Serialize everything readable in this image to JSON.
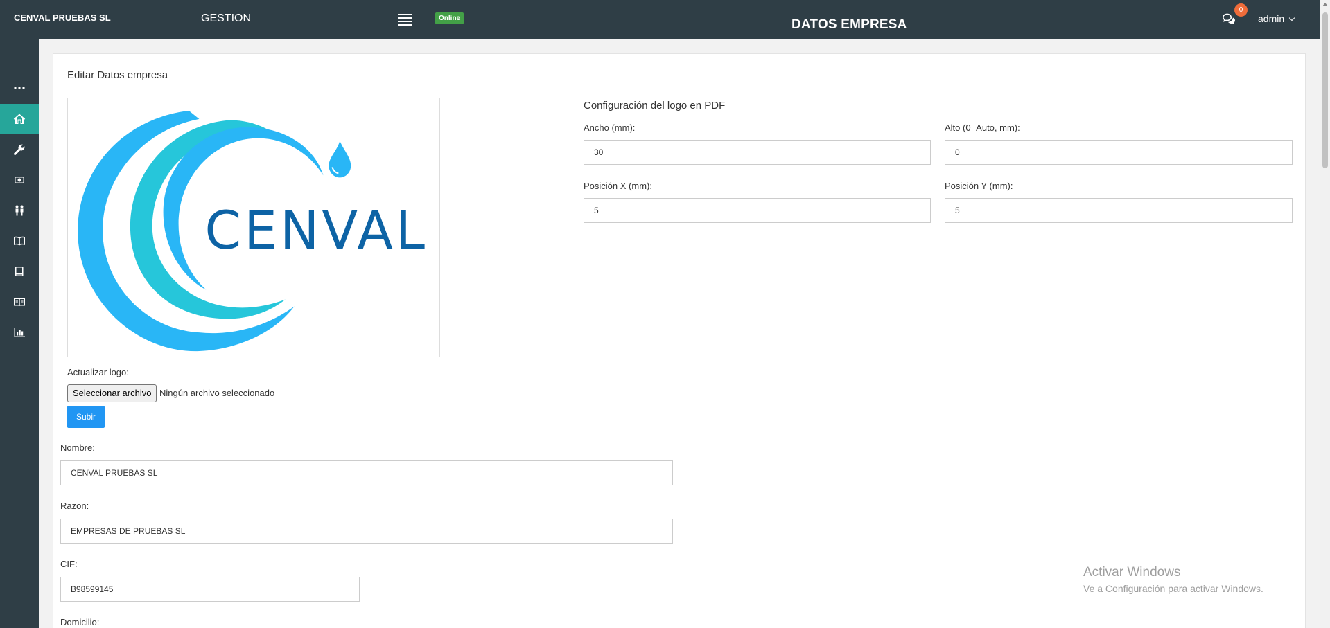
{
  "header": {
    "brand": "CENVAL PRUEBAS SL",
    "module": "GESTION",
    "status": "Online",
    "title": "DATOS EMPRESA",
    "notifications_count": "0",
    "user": "admin"
  },
  "sidebar": {
    "items": [
      {
        "icon": "more-icon"
      },
      {
        "icon": "home-icon",
        "active": true
      },
      {
        "icon": "wrench-icon"
      },
      {
        "icon": "money-icon"
      },
      {
        "icon": "users-icon"
      },
      {
        "icon": "book-open-icon"
      },
      {
        "icon": "book-icon"
      },
      {
        "icon": "reader-icon"
      },
      {
        "icon": "bar-chart-icon"
      }
    ]
  },
  "card": {
    "title": "Editar Datos empresa",
    "logo_text": "CENVAL",
    "update_logo_label": "Actualizar logo:",
    "file_button": "Seleccionar archivo",
    "file_status": "Ningún archivo seleccionado",
    "upload_button": "Subir"
  },
  "pdf_logo": {
    "title": "Configuración del logo en PDF",
    "width_label": "Ancho (mm):",
    "width_value": "30",
    "height_label": "Alto (0=Auto, mm):",
    "height_value": "0",
    "pos_x_label": "Posición X (mm):",
    "pos_x_value": "5",
    "pos_y_label": "Posición Y (mm):",
    "pos_y_value": "5"
  },
  "company": {
    "name_label": "Nombre:",
    "name_value": "CENVAL PRUEBAS SL",
    "reason_label": "Razon:",
    "reason_value": "EMPRESAS DE PRUEBAS SL",
    "cif_label": "CIF:",
    "cif_value": "B98599145",
    "address_label": "Domicilio:"
  },
  "watermark": {
    "line1": "Activar Windows",
    "line2": "Ve a Configuración para activar Windows."
  },
  "colors": {
    "topbar": "#2f3e46",
    "active": "#26a69a",
    "online": "#43a047",
    "primary": "#2196f3",
    "badge": "#ef6c3a"
  }
}
